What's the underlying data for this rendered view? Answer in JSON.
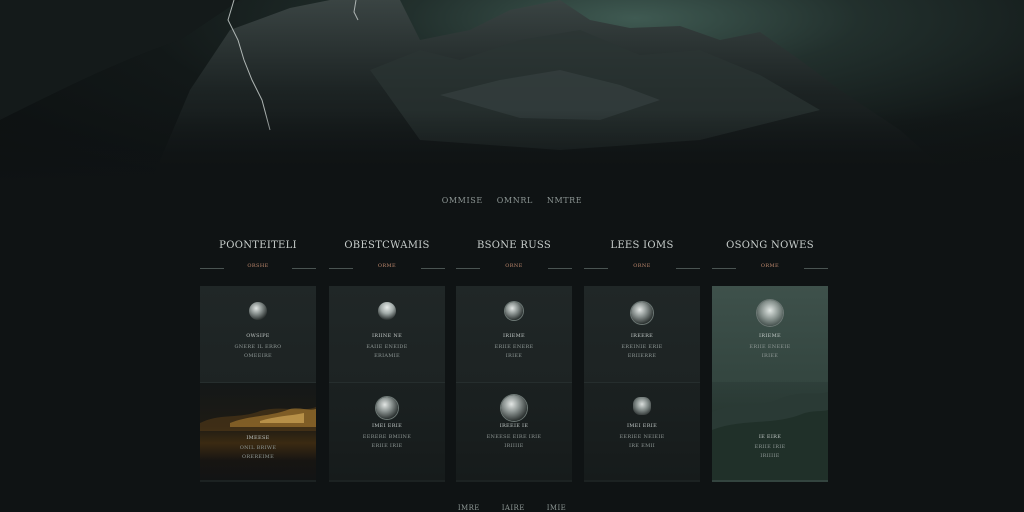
{
  "nav": {
    "items": [
      "OMMISE",
      "OMNRL",
      "NMTRE"
    ]
  },
  "columns": [
    {
      "title": "POONTEITELI",
      "tag": "ORSHE",
      "top": {
        "icon": "moon-orb-icon",
        "lines": [
          "OWSIPE",
          "GNERE IL ERRO",
          "OMEEIRE"
        ]
      },
      "bottom": {
        "icon": "",
        "lines": [
          "IMEESE",
          "ONIL BRIWE",
          "OREREIME"
        ]
      }
    },
    {
      "title": "OBESTCWAMIS",
      "tag": "ORME",
      "top": {
        "icon": "skull-icon",
        "lines": [
          "IRIINE NE",
          "EAIIE ENEIDE",
          "ERIAMIE"
        ]
      },
      "bottom": {
        "icon": "globe-icon",
        "lines": [
          "IMEI ERIE",
          "EERERE BMIINE",
          "ERIIE IRIE"
        ]
      }
    },
    {
      "title": "BSONE RUSS",
      "tag": "ORNE",
      "top": {
        "icon": "moon-orb-icon",
        "lines": [
          "IRIEME",
          "ERIIE ENERE",
          "IRIEE"
        ]
      },
      "bottom": {
        "icon": "moon-orb-icon",
        "lines": [
          "IREEIE IE",
          "ENEESE EIRE IRIE",
          "IRIIIIE"
        ]
      }
    },
    {
      "title": "LEES IOMS",
      "tag": "ORNE",
      "top": {
        "icon": "moon-orb-icon",
        "lines": [
          "IREERE",
          "EREINIE ERIE",
          "ERIIERRE"
        ]
      },
      "bottom": {
        "icon": "figure-icon",
        "lines": [
          "IMEI ERIE",
          "EERIEE NEIEIE",
          "IRE EMII"
        ]
      }
    },
    {
      "title": "OSONG NOWES",
      "tag": "ORME",
      "top": {
        "icon": "portrait-orb-icon",
        "lines": [
          "IRIEME",
          "ERIIE ENEEIE",
          "IRIEE"
        ]
      },
      "bottom": {
        "icon": "",
        "lines": [
          "IE EIRE",
          "ERIIE IRIE",
          "IRIIIIE"
        ]
      }
    }
  ],
  "pager": {
    "items": [
      "IMRE",
      "IAIRE",
      "IMIE"
    ]
  }
}
